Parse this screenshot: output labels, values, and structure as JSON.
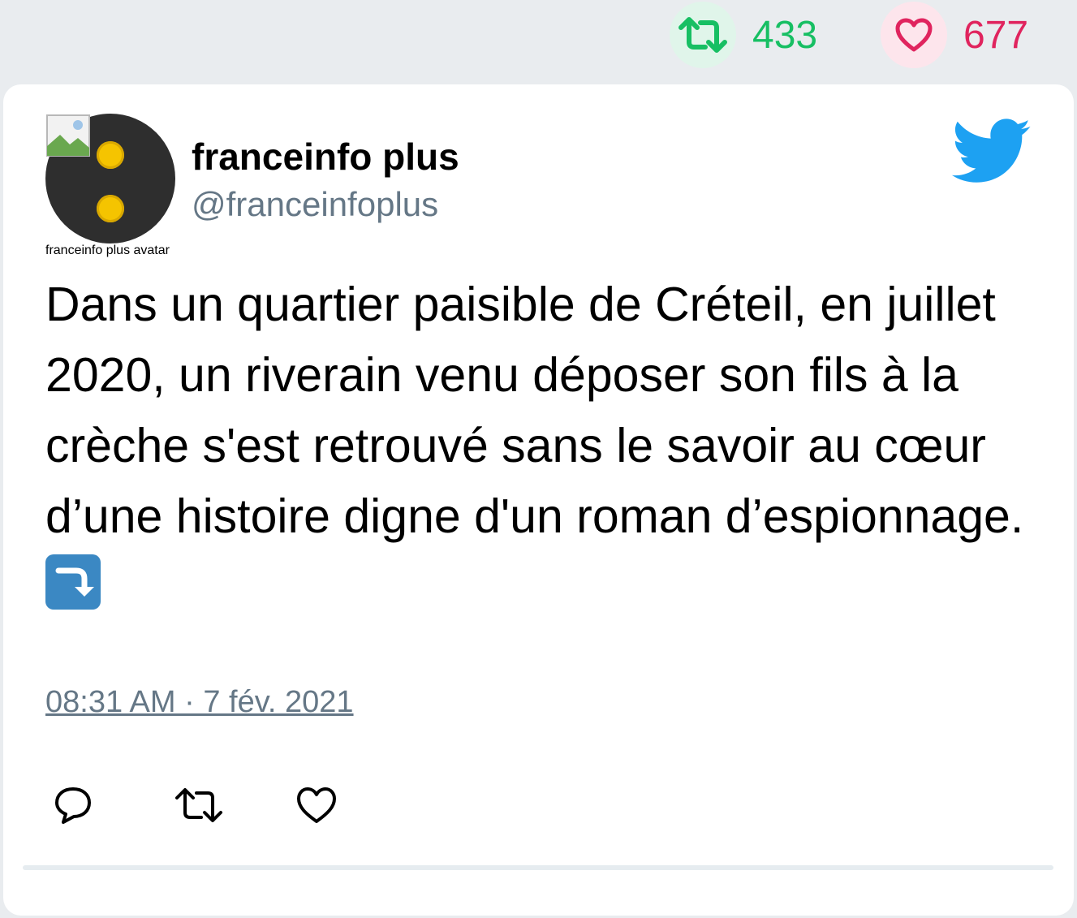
{
  "stats": {
    "retweet_count": "433",
    "like_count": "677",
    "retweet_color": "#17bf63",
    "like_color": "#e0245e"
  },
  "tweet": {
    "author_name": "franceinfo plus",
    "author_handle": "@franceinfoplus",
    "avatar_alt": "franceinfo\nplus\navatar",
    "text": "Dans un quartier paisible de Créteil, en juillet 2020, un riverain venu déposer son fils à la crèche s'est retrouvé sans le savoir au cœur d’une histoire digne d'un roman d’espionnage.",
    "emoji": "right-arrow-curving-down-icon",
    "timestamp": "08:31 AM · 7 fév. 2021"
  },
  "icons": {
    "brand": "twitter-bird-icon",
    "actions": [
      "reply-icon",
      "retweet-icon",
      "like-icon"
    ]
  },
  "colors": {
    "brand_blue": "#1da1f2",
    "muted": "#657786"
  }
}
